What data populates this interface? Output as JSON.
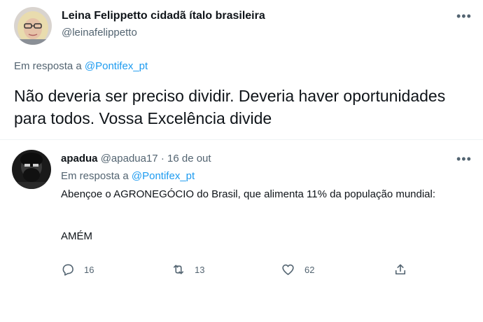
{
  "tweet1": {
    "author_name": "Leina Felippetto cidadã ítalo brasileira",
    "handle": "@leinafelippetto",
    "reply_prefix": "Em resposta a",
    "reply_to": "@Pontifex_pt",
    "text": "Não deveria ser preciso dividir. Deveria haver oportunidades para todos. Vossa Excelência divide"
  },
  "tweet2": {
    "author_name": "apadua",
    "handle": "@apadua17",
    "separator": "·",
    "date": "16 de out",
    "reply_prefix": "Em resposta a",
    "reply_to": "@Pontifex_pt",
    "text_line1": "Abençoe o AGRONEGÓCIO do Brasil, que alimenta 11% da população mundial:",
    "text_line2": "AMÉM",
    "actions": {
      "reply_icon": "reply-bubble-icon",
      "replies": "16",
      "retweet_icon": "retweet-icon",
      "retweets": "13",
      "like_icon": "heart-icon",
      "likes": "62",
      "share_icon": "share-icon"
    }
  },
  "more_glyph": "•••",
  "colors": {
    "link": "#1d9bf0",
    "secondary_text": "#536471",
    "primary_text": "#0f1419",
    "divider": "#eff3f4"
  }
}
